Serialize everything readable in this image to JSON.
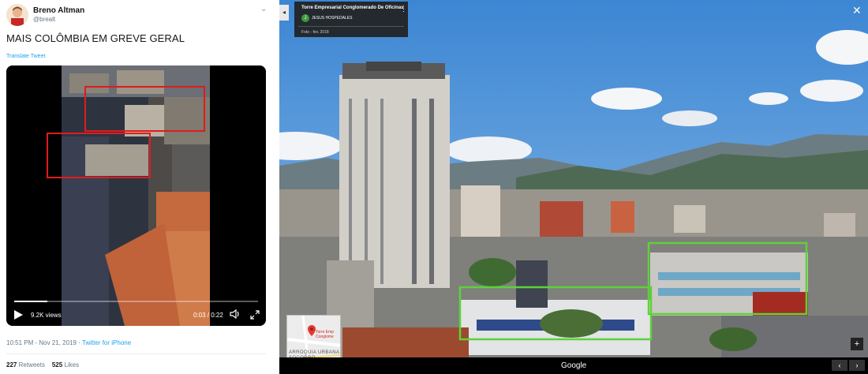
{
  "tweet": {
    "display_name": "Breno Altman",
    "handle": "@brealt",
    "text": "MAIS COLÔMBIA EM GREVE GERAL",
    "translate_label": "Translate Tweet",
    "video": {
      "views": "9.2K views",
      "time": "0:03 / 0:22",
      "progress": 0.136
    },
    "timestamp": "10:51 PM - Nov 21, 2019",
    "separator": " · ",
    "source_link": "Twitter for iPhone",
    "retweets_count": "227",
    "retweets_label": "Retweets",
    "likes_count": "525",
    "likes_label": "Likes"
  },
  "streetview": {
    "place_title": "Torre Empresarial Conglomerado De Oficinas",
    "contributor_initial": "J",
    "contributor_name": "JESUS HOSPEDALES",
    "photo_date": "Foto - fev. 2018",
    "minimap_place": "Torre Emp Conglome",
    "minimap_area": "ARROQUIA URBANA SOCORRO",
    "logo": "Google",
    "zoom_in": "+",
    "close_symbol": "✕",
    "prev_symbol": "‹",
    "next_symbol": "›",
    "collapse_symbol": "◂"
  },
  "colors": {
    "link_blue": "#1da1f2",
    "highlight_red": "#e01b1b",
    "highlight_green": "#5ed13a",
    "sky": "#3f8ad6"
  },
  "icons": [
    "caret-down-icon",
    "play-icon",
    "volume-icon",
    "fullscreen-icon",
    "close-icon",
    "more-vert-icon",
    "map-pin-icon",
    "chevron-left-icon",
    "chevron-right-icon"
  ]
}
